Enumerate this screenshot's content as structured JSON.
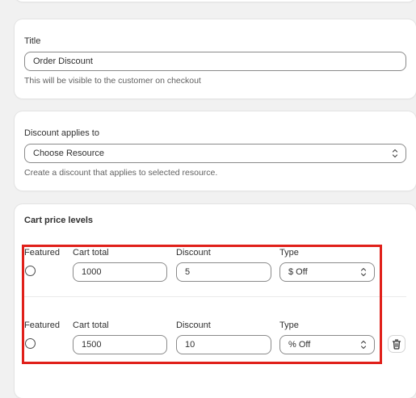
{
  "title_card": {
    "label": "Title",
    "value": "Order Discount",
    "help": "This will be visible to the customer on checkout"
  },
  "resource_card": {
    "label": "Discount applies to",
    "selected": "Choose Resource",
    "help": "Create a discount that applies to selected resource."
  },
  "levels_card": {
    "heading": "Cart price levels",
    "columns": {
      "featured": "Featured",
      "cart_total": "Cart total",
      "discount": "Discount",
      "type": "Type"
    },
    "rows": [
      {
        "featured": false,
        "cart_total": "1000",
        "discount": "5",
        "type": "$ Off"
      },
      {
        "featured": false,
        "cart_total": "1500",
        "discount": "10",
        "type": "% Off"
      }
    ]
  },
  "colors": {
    "highlight": "#e0201a",
    "background": "#f1f1f1",
    "card": "#ffffff"
  },
  "icons": {
    "select": "chevron-up-down-icon",
    "delete": "trash-icon"
  }
}
